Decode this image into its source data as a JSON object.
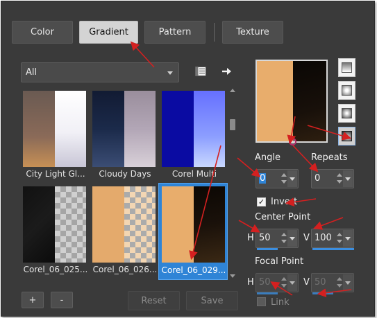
{
  "tabs": [
    {
      "label": "Color",
      "active": false
    },
    {
      "label": "Gradient",
      "active": true
    },
    {
      "label": "Pattern",
      "active": false
    },
    {
      "label": "Texture",
      "active": false
    }
  ],
  "category": {
    "selected": "All"
  },
  "icons": {
    "save_library": "library-icon",
    "export": "arrow-right-icon"
  },
  "thumbnails": [
    {
      "caption": "City Light Gl..."
    },
    {
      "caption": "Cloudy Days"
    },
    {
      "caption": "Corel Multi"
    },
    {
      "caption": "Corel_06_025..."
    },
    {
      "caption": "Corel_06_026..."
    },
    {
      "caption": "Corel_06_029...",
      "selected": true
    }
  ],
  "bottom": {
    "add": "+",
    "remove": "-",
    "reset": "Reset",
    "save": "Save"
  },
  "props": {
    "angle_label": "Angle",
    "angle": "0",
    "repeats_label": "Repeats",
    "repeats": "0",
    "invert_label": "Invert",
    "invert": true,
    "center_label": "Center Point",
    "center_h_label": "H",
    "center_h": "50",
    "center_v_label": "V",
    "center_v": "100",
    "focal_label": "Focal Point",
    "focal_h_label": "H",
    "focal_h": "50",
    "focal_v_label": "V",
    "focal_v": "50",
    "link_label": "Link",
    "link": false
  },
  "colors": {
    "accent": "#2f84d6",
    "arrow": "#d42020",
    "gradient_light": "#e8ad6c",
    "gradient_dark": "#140d07"
  }
}
